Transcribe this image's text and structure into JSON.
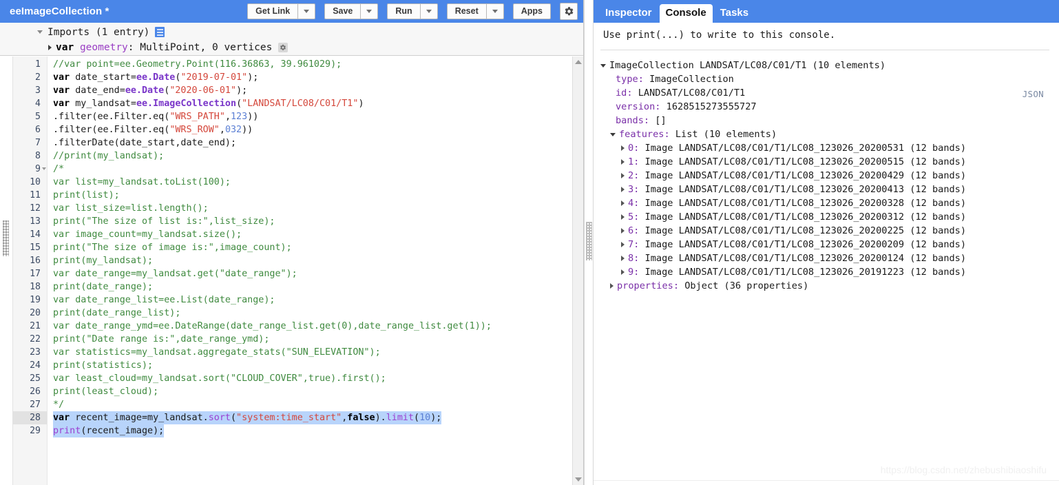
{
  "toolbar": {
    "script_title": "eeImageCollection *",
    "buttons": [
      {
        "label": "Get Link",
        "has_dropdown": true
      },
      {
        "label": "Save",
        "has_dropdown": true
      },
      {
        "label": "Run",
        "has_dropdown": true
      },
      {
        "label": "Reset",
        "has_dropdown": true
      },
      {
        "label": "Apps",
        "has_dropdown": false
      }
    ],
    "settings_icon": "gear-icon",
    "accent_color": "#4a86e8"
  },
  "imports": {
    "header": "Imports (1 entry)",
    "header_icon": "list-icon",
    "entry": {
      "keyword": "var",
      "name": "geometry",
      "detail": ": MultiPoint, 0 vertices",
      "gear_icon": "gear-icon"
    }
  },
  "editor": {
    "active_line": 28,
    "selected_lines": [
      28,
      29
    ],
    "total_lines": 29,
    "lines": [
      {
        "n": 1,
        "fold": false,
        "tokens": [
          {
            "t": "//var point=ee.Geometry.Point(116.36863, 39.961029);",
            "c": "tk-comment"
          }
        ]
      },
      {
        "n": 2,
        "fold": false,
        "tokens": [
          {
            "t": "var",
            "c": "tk-keyword"
          },
          {
            "t": " date_start=",
            "c": "tk-plain"
          },
          {
            "t": "ee.Date",
            "c": "tk-builtin"
          },
          {
            "t": "(",
            "c": "tk-plain"
          },
          {
            "t": "\"2019-07-01\"",
            "c": "tk-str"
          },
          {
            "t": ");",
            "c": "tk-plain"
          }
        ]
      },
      {
        "n": 3,
        "fold": false,
        "tokens": [
          {
            "t": "var",
            "c": "tk-keyword"
          },
          {
            "t": " date_end=",
            "c": "tk-plain"
          },
          {
            "t": "ee.Date",
            "c": "tk-builtin"
          },
          {
            "t": "(",
            "c": "tk-plain"
          },
          {
            "t": "\"2020-06-01\"",
            "c": "tk-str"
          },
          {
            "t": ");",
            "c": "tk-plain"
          }
        ]
      },
      {
        "n": 4,
        "fold": false,
        "tokens": [
          {
            "t": "var",
            "c": "tk-keyword"
          },
          {
            "t": " my_landsat=",
            "c": "tk-plain"
          },
          {
            "t": "ee.ImageCollection",
            "c": "tk-builtin"
          },
          {
            "t": "(",
            "c": "tk-plain"
          },
          {
            "t": "\"LANDSAT/LC08/C01/T1\"",
            "c": "tk-str"
          },
          {
            "t": ")",
            "c": "tk-plain"
          }
        ]
      },
      {
        "n": 5,
        "fold": false,
        "tokens": [
          {
            "t": ".filter(ee.Filter.eq(",
            "c": "tk-plain"
          },
          {
            "t": "\"WRS_PATH\"",
            "c": "tk-str"
          },
          {
            "t": ",",
            "c": "tk-plain"
          },
          {
            "t": "123",
            "c": "tk-num"
          },
          {
            "t": "))",
            "c": "tk-plain"
          }
        ]
      },
      {
        "n": 6,
        "fold": false,
        "tokens": [
          {
            "t": ".filter(ee.Filter.eq(",
            "c": "tk-plain"
          },
          {
            "t": "\"WRS_ROW\"",
            "c": "tk-str"
          },
          {
            "t": ",",
            "c": "tk-plain"
          },
          {
            "t": "032",
            "c": "tk-num"
          },
          {
            "t": "))",
            "c": "tk-plain"
          }
        ]
      },
      {
        "n": 7,
        "fold": false,
        "tokens": [
          {
            "t": ".filterDate(date_start,date_end);",
            "c": "tk-plain"
          }
        ]
      },
      {
        "n": 8,
        "fold": false,
        "tokens": [
          {
            "t": "//print(my_landsat);",
            "c": "tk-comment"
          }
        ]
      },
      {
        "n": 9,
        "fold": true,
        "tokens": [
          {
            "t": "/*",
            "c": "tk-comment"
          }
        ]
      },
      {
        "n": 10,
        "fold": false,
        "tokens": [
          {
            "t": "var list=my_landsat.toList(100);",
            "c": "tk-comment"
          }
        ]
      },
      {
        "n": 11,
        "fold": false,
        "tokens": [
          {
            "t": "print(list);",
            "c": "tk-comment"
          }
        ]
      },
      {
        "n": 12,
        "fold": false,
        "tokens": [
          {
            "t": "var list_size=list.length();",
            "c": "tk-comment"
          }
        ]
      },
      {
        "n": 13,
        "fold": false,
        "tokens": [
          {
            "t": "print(\"The size of list is:\",list_size);",
            "c": "tk-comment"
          }
        ]
      },
      {
        "n": 14,
        "fold": false,
        "tokens": [
          {
            "t": "var image_count=my_landsat.size();",
            "c": "tk-comment"
          }
        ]
      },
      {
        "n": 15,
        "fold": false,
        "tokens": [
          {
            "t": "print(\"The size of image is:\",image_count);",
            "c": "tk-comment"
          }
        ]
      },
      {
        "n": 16,
        "fold": false,
        "tokens": [
          {
            "t": "print(my_landsat);",
            "c": "tk-comment"
          }
        ]
      },
      {
        "n": 17,
        "fold": false,
        "tokens": [
          {
            "t": "var date_range=my_landsat.get(\"date_range\");",
            "c": "tk-comment"
          }
        ]
      },
      {
        "n": 18,
        "fold": false,
        "tokens": [
          {
            "t": "print(date_range);",
            "c": "tk-comment"
          }
        ]
      },
      {
        "n": 19,
        "fold": false,
        "tokens": [
          {
            "t": "var date_range_list=ee.List(date_range);",
            "c": "tk-comment"
          }
        ]
      },
      {
        "n": 20,
        "fold": false,
        "tokens": [
          {
            "t": "print(date_range_list);",
            "c": "tk-comment"
          }
        ]
      },
      {
        "n": 21,
        "fold": false,
        "tokens": [
          {
            "t": "var date_range_ymd=ee.DateRange(date_range_list.get(0),date_range_list.get(1));",
            "c": "tk-comment"
          }
        ]
      },
      {
        "n": 22,
        "fold": false,
        "tokens": [
          {
            "t": "print(\"Date range is:\",date_range_ymd);",
            "c": "tk-comment"
          }
        ]
      },
      {
        "n": 23,
        "fold": false,
        "tokens": [
          {
            "t": "var statistics=my_landsat.aggregate_stats(\"SUN_ELEVATION\");",
            "c": "tk-comment"
          }
        ]
      },
      {
        "n": 24,
        "fold": false,
        "tokens": [
          {
            "t": "print(statistics);",
            "c": "tk-comment"
          }
        ]
      },
      {
        "n": 25,
        "fold": false,
        "tokens": [
          {
            "t": "var least_cloud=my_landsat.sort(\"CLOUD_COVER\",true).first();",
            "c": "tk-comment"
          }
        ]
      },
      {
        "n": 26,
        "fold": false,
        "tokens": [
          {
            "t": "print(least_cloud);",
            "c": "tk-comment"
          }
        ]
      },
      {
        "n": 27,
        "fold": false,
        "tokens": [
          {
            "t": "*/",
            "c": "tk-comment"
          }
        ]
      },
      {
        "n": 28,
        "fold": false,
        "tokens": [
          {
            "t": "var",
            "c": "tk-keyword"
          },
          {
            "t": " recent_image=my_landsat.",
            "c": "tk-plain"
          },
          {
            "t": "sort",
            "c": "tk-fn"
          },
          {
            "t": "(",
            "c": "tk-plain"
          },
          {
            "t": "\"system:time_start\"",
            "c": "tk-str"
          },
          {
            "t": ",",
            "c": "tk-plain"
          },
          {
            "t": "false",
            "c": "tk-bool"
          },
          {
            "t": ").",
            "c": "tk-plain"
          },
          {
            "t": "limit",
            "c": "tk-fn"
          },
          {
            "t": "(",
            "c": "tk-plain"
          },
          {
            "t": "10",
            "c": "tk-num"
          },
          {
            "t": ");",
            "c": "tk-plain"
          }
        ]
      },
      {
        "n": 29,
        "fold": false,
        "tokens": [
          {
            "t": "print",
            "c": "tk-fn"
          },
          {
            "t": "(recent_image);",
            "c": "tk-plain"
          }
        ]
      }
    ]
  },
  "right_panel": {
    "tabs": [
      {
        "label": "Inspector",
        "active": false
      },
      {
        "label": "Console",
        "active": true
      },
      {
        "label": "Tasks",
        "active": false
      }
    ],
    "hint": "Use print(...) to write to this console.",
    "json_link": "JSON",
    "root": {
      "text": "ImageCollection LANDSAT/LC08/C01/T1 (10 elements)",
      "expanded": true
    },
    "properties_rows": [
      {
        "key": "type",
        "value": "ImageCollection"
      },
      {
        "key": "id",
        "value": "LANDSAT/LC08/C01/T1"
      },
      {
        "key": "version",
        "value": "1628515273555727"
      },
      {
        "key": "bands",
        "value": "[]"
      }
    ],
    "features_label": "features",
    "features_value": "List (10 elements)",
    "features": [
      {
        "index": "0",
        "value": "Image LANDSAT/LC08/C01/T1/LC08_123026_20200531 (12 bands)"
      },
      {
        "index": "1",
        "value": "Image LANDSAT/LC08/C01/T1/LC08_123026_20200515 (12 bands)"
      },
      {
        "index": "2",
        "value": "Image LANDSAT/LC08/C01/T1/LC08_123026_20200429 (12 bands)"
      },
      {
        "index": "3",
        "value": "Image LANDSAT/LC08/C01/T1/LC08_123026_20200413 (12 bands)"
      },
      {
        "index": "4",
        "value": "Image LANDSAT/LC08/C01/T1/LC08_123026_20200328 (12 bands)"
      },
      {
        "index": "5",
        "value": "Image LANDSAT/LC08/C01/T1/LC08_123026_20200312 (12 bands)"
      },
      {
        "index": "6",
        "value": "Image LANDSAT/LC08/C01/T1/LC08_123026_20200225 (12 bands)"
      },
      {
        "index": "7",
        "value": "Image LANDSAT/LC08/C01/T1/LC08_123026_20200209 (12 bands)"
      },
      {
        "index": "8",
        "value": "Image LANDSAT/LC08/C01/T1/LC08_123026_20200124 (12 bands)"
      },
      {
        "index": "9",
        "value": "Image LANDSAT/LC08/C01/T1/LC08_123026_20191223 (12 bands)"
      }
    ],
    "properties_node": {
      "key": "properties",
      "value": "Object (36 properties)"
    }
  },
  "watermark": "https://blog.csdn.net/zhebushibiaoshifu"
}
